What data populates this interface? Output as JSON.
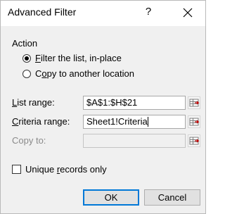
{
  "window": {
    "title": "Advanced Filter",
    "help_label": "?"
  },
  "action": {
    "label": "Action",
    "options": [
      {
        "key": "F",
        "rest": "ilter the list, in-place",
        "checked": true
      },
      {
        "prefix": "C",
        "key": "o",
        "rest": "py to another location",
        "checked": false
      }
    ]
  },
  "fields": {
    "list_range": {
      "key": "L",
      "rest": "ist range:",
      "value": "$A$1:$H$21"
    },
    "criteria_range": {
      "key": "C",
      "rest": "riteria range:",
      "value": "Sheet1!Criteria"
    },
    "copy_to": {
      "label": "Copy to:",
      "value": ""
    }
  },
  "unique": {
    "prefix": "Unique ",
    "key": "r",
    "rest": "ecords only",
    "checked": false
  },
  "buttons": {
    "ok": "OK",
    "cancel": "Cancel"
  },
  "colors": {
    "accent": "#0078d7",
    "background": "#f0f0f0"
  },
  "icons": {
    "close": "close-icon",
    "range_picker": "range-picker-icon"
  }
}
